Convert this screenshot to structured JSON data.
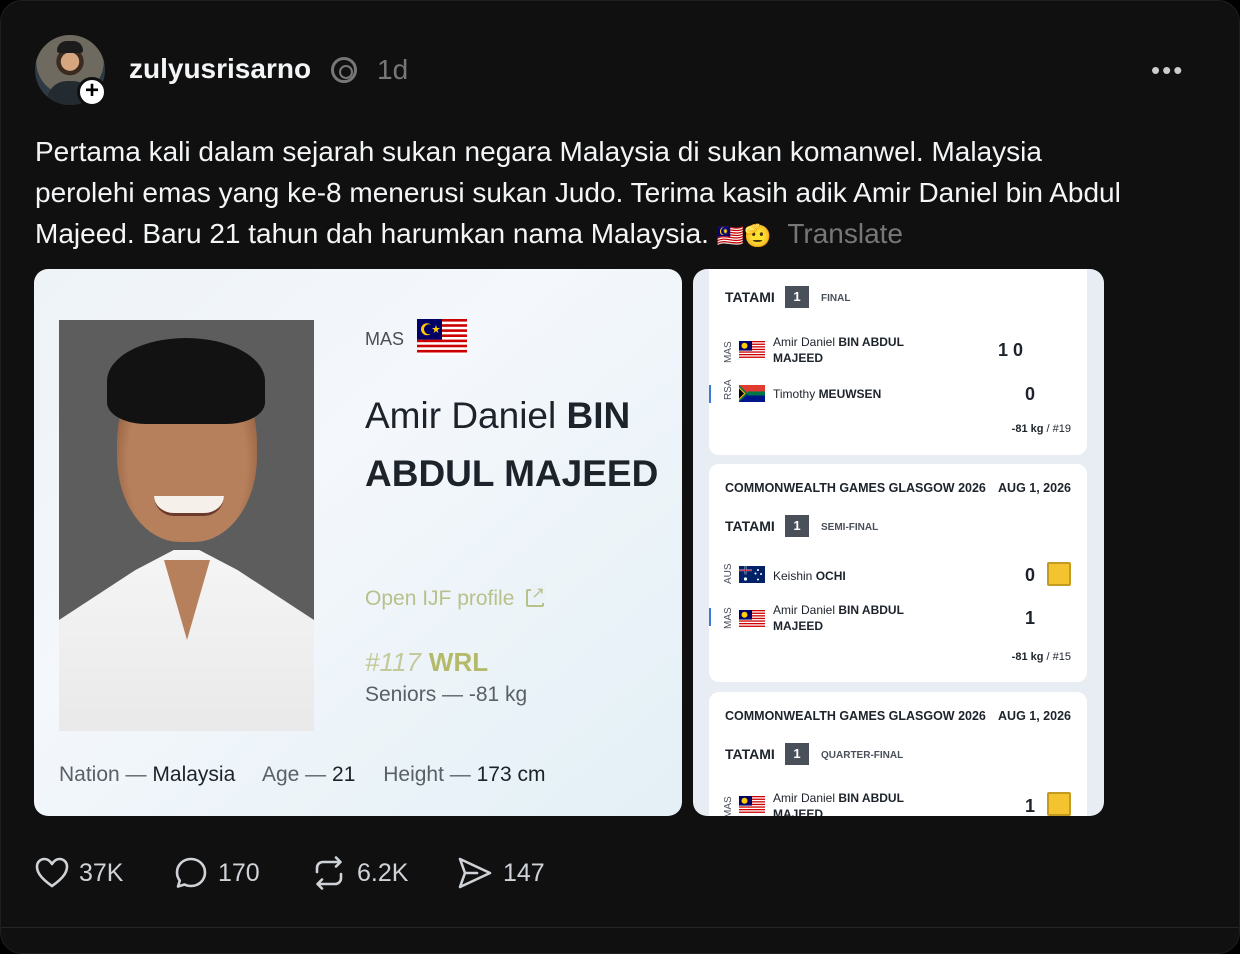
{
  "post": {
    "username": "zulyusrisarno",
    "time": "1d",
    "follow_symbol": "+",
    "more_symbol": "•••",
    "text": "Pertama kali dalam sejarah sukan negara Malaysia di sukan komanwel. Malaysia perolehi emas yang ke-8 menerusi sukan Judo. Terima kasih adik Amir Daniel bin Abdul Majeed. Baru 21 tahun dah harumkan nama Malaysia.",
    "emoji": "🇲🇾🫡",
    "translate": "Translate"
  },
  "profile_card": {
    "nation_code": "MAS",
    "name_regular": "Amir Daniel ",
    "name_bold": "BIN ABDUL MAJEED",
    "ijf_link": "Open IJF profile",
    "rank_number": "#117",
    "rank_label": "WRL",
    "category": "Seniors — -81 kg",
    "nation_label": "Nation",
    "nation_value": "Malaysia",
    "age_label": "Age",
    "age_value": "21",
    "height_label": "Height",
    "height_value": "173 cm",
    "dash": "—"
  },
  "matches": [
    {
      "tatami": "TATAMI",
      "tatami_num": "1",
      "round": "FINAL",
      "p1_code": "MAS",
      "p1_name_regular": "Amir Daniel ",
      "p1_name_bold": "BIN ABDUL MAJEED",
      "p1_score": "1  0",
      "p2_code": "RSA",
      "p2_name_regular": "Timothy ",
      "p2_name_bold": "MEUWSEN",
      "p2_score": "0",
      "weight": "-81 kg",
      "pool": " / #19"
    },
    {
      "event": "COMMONWEALTH GAMES GLASGOW 2026",
      "date": "AUG 1, 2026",
      "tatami": "TATAMI",
      "tatami_num": "1",
      "round": "SEMI-FINAL",
      "p1_code": "AUS",
      "p1_name_regular": "Keishin ",
      "p1_name_bold": "OCHI",
      "p1_score": "0",
      "p2_code": "MAS",
      "p2_name_regular": "Amir Daniel ",
      "p2_name_bold": "BIN ABDUL MAJEED",
      "p2_score": "1",
      "weight": "-81 kg",
      "pool": " / #15"
    },
    {
      "event": "COMMONWEALTH GAMES GLASGOW 2026",
      "date": "AUG 1, 2026",
      "tatami": "TATAMI",
      "tatami_num": "1",
      "round": "QUARTER-FINAL",
      "p1_code": "MAS",
      "p1_name_regular": "Amir Daniel ",
      "p1_name_bold": "BIN ABDUL MAJEED",
      "p1_score": "1"
    }
  ],
  "actions": {
    "likes": "37K",
    "replies": "170",
    "reposts": "6.2K",
    "shares": "147"
  },
  "colors": {
    "background": "#101010",
    "secondary_text": "#777777",
    "wrl_accent": "#b5ba6b",
    "penalty_yellow": "#f4c430"
  },
  "icons": [
    "heart-icon",
    "comment-icon",
    "repost-icon",
    "share-icon",
    "external-link-icon",
    "verified-icon",
    "more-icon"
  ]
}
